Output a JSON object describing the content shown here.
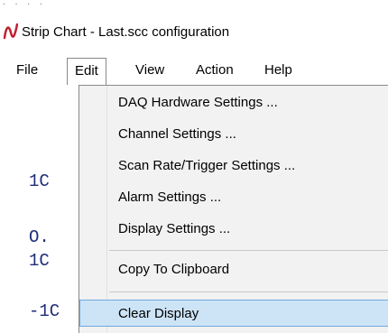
{
  "window": {
    "title": "Strip Chart - Last.scc configuration",
    "icon": "strip-chart-app-icon",
    "accent_color": "#c0202f"
  },
  "menubar": {
    "items": [
      {
        "label": "File"
      },
      {
        "label": "Edit"
      },
      {
        "label": "View"
      },
      {
        "label": "Action"
      },
      {
        "label": "Help"
      }
    ],
    "open_menu": "Edit"
  },
  "edit_menu": {
    "items": [
      {
        "label": "DAQ Hardware Settings ..."
      },
      {
        "label": "Channel Settings ..."
      },
      {
        "label": "Scan Rate/Trigger Settings ..."
      },
      {
        "label": "Alarm Settings ..."
      },
      {
        "label": "Display Settings ..."
      },
      {
        "label": "Copy To Clipboard"
      },
      {
        "label": "Clear Display"
      }
    ],
    "highlighted": "Clear Display",
    "highlight_color": "#cde4f7"
  },
  "background": {
    "text_fragments": [
      {
        "text": "1C"
      },
      {
        "text": "O."
      },
      {
        "text": "1C"
      },
      {
        "text": "-1C"
      }
    ],
    "text_color": "#1f2d7a"
  }
}
